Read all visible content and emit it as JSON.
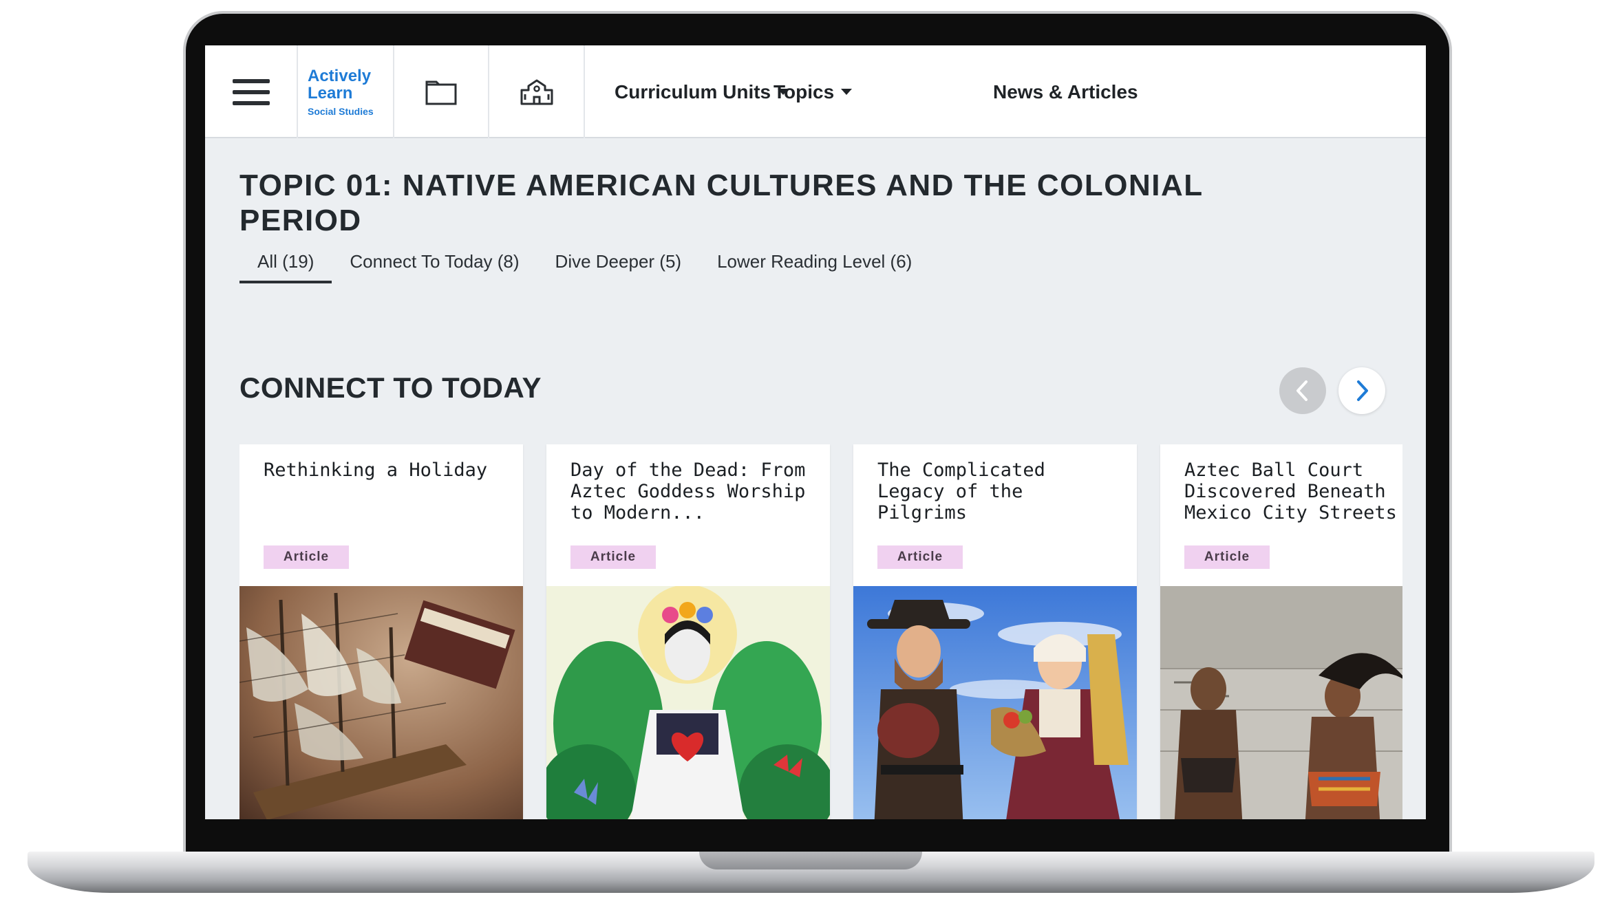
{
  "nav": {
    "logo_line1": "Actively",
    "logo_line2": "Learn",
    "logo_line3": "Social Studies",
    "links": [
      {
        "label": "Curriculum Units"
      },
      {
        "label": "Topics"
      },
      {
        "label": "News & Articles"
      }
    ]
  },
  "page": {
    "title": "TOPIC 01: NATIVE AMERICAN CULTURES AND THE COLONIAL PERIOD",
    "tabs": [
      {
        "label": "All (19)",
        "active": true
      },
      {
        "label": "Connect To Today (8)"
      },
      {
        "label": "Dive Deeper (5)"
      },
      {
        "label": "Lower Reading Level (6)"
      }
    ]
  },
  "section": {
    "title": "CONNECT TO TODAY",
    "cards": [
      {
        "title": "Rethinking a Holiday",
        "badge": "Article"
      },
      {
        "title": "Day of the Dead: From Aztec Goddess Worship to Modern...",
        "badge": "Article"
      },
      {
        "title": "The Complicated Legacy of the Pilgrims",
        "badge": "Article"
      },
      {
        "title": "Aztec Ball Court Discovered Beneath Mexico City Streets",
        "badge": "Article"
      }
    ]
  },
  "colors": {
    "brand": "#1e7bd6",
    "badge_bg": "#f0d1f0",
    "page_bg": "#eceff2",
    "arrow_active": "#1e7bd6"
  },
  "icons": [
    "menu-icon",
    "folder-icon",
    "school-icon",
    "chevron-left-icon",
    "chevron-right-icon",
    "bookmark-icon",
    "plus-icon"
  ]
}
